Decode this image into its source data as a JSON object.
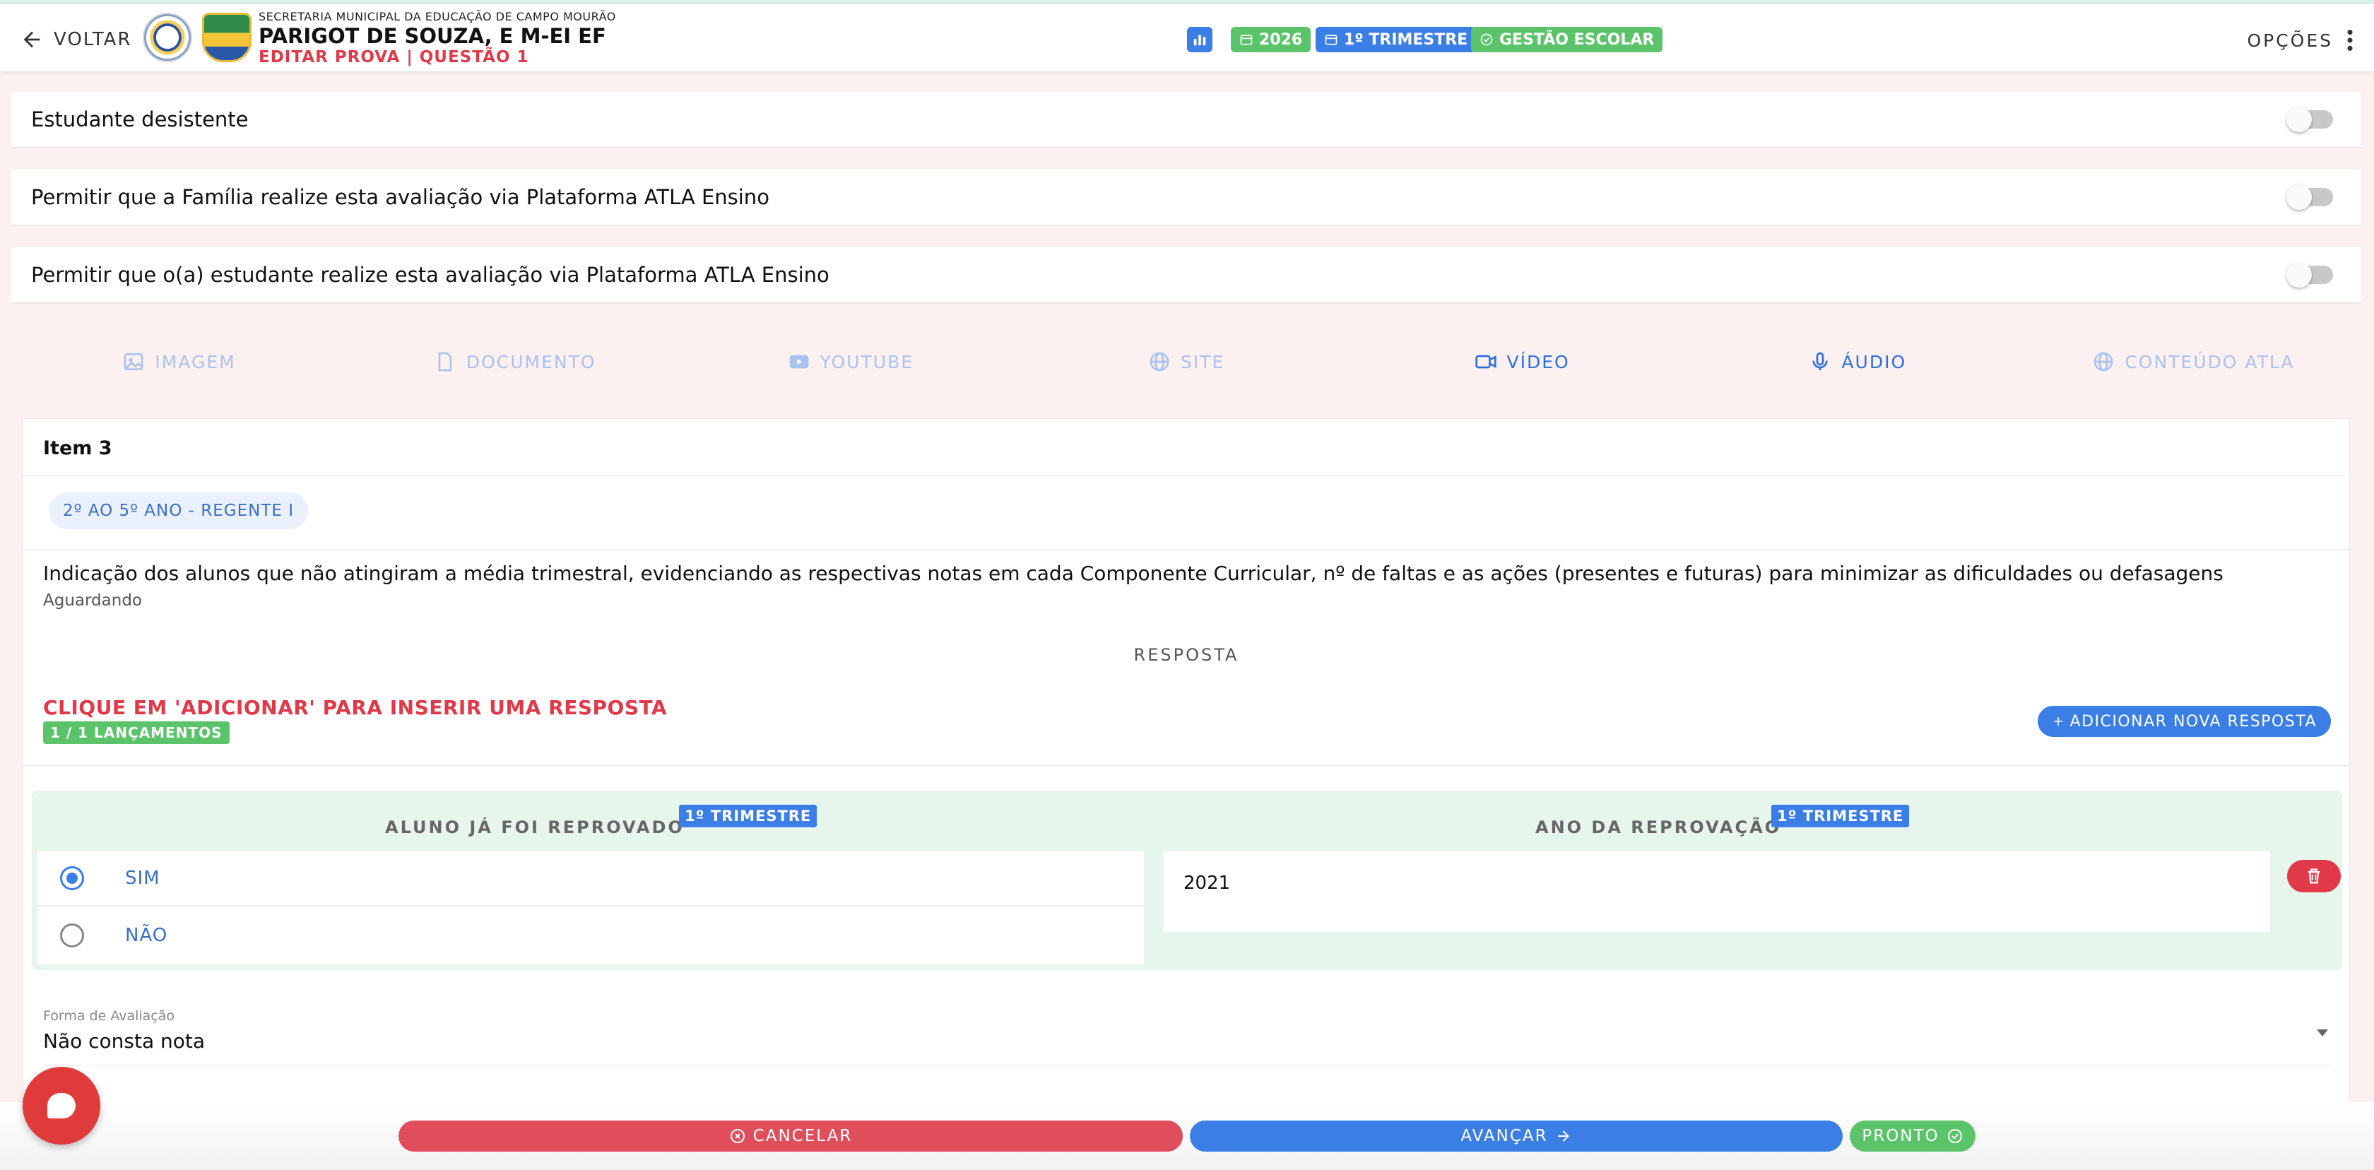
{
  "header": {
    "back_label": "VOLTAR",
    "org_name": "SECRETARIA MUNICIPAL DA EDUCAÇÃO DE CAMPO MOURÃO",
    "school_name": "PARIGOT DE SOUZA, E M-EI EF",
    "edit_title": "EDITAR PROVA | QUESTÃO 1",
    "chips": {
      "year": "2026",
      "term": "1º TRIMESTRE",
      "management": "GESTÃO ESCOLAR"
    },
    "options_label": "OPÇÕES"
  },
  "toggles": [
    {
      "label": "Estudante desistente",
      "on": false
    },
    {
      "label": "Permitir que a Família realize esta avaliação via Plataforma ATLA Ensino",
      "on": false
    },
    {
      "label": "Permitir que o(a) estudante realize esta avaliação via Plataforma ATLA Ensino",
      "on": false
    }
  ],
  "media_tabs": [
    "IMAGEM",
    "DOCUMENTO",
    "YOUTUBE",
    "SITE",
    "VÍDEO",
    "ÁUDIO",
    "CONTEÚDO ATLA"
  ],
  "card": {
    "item_title": "Item 3",
    "grade_chip": "2º AO 5º ANO - REGENTE I",
    "question": "Indicação dos alunos que não atingiram a média trimestral, evidenciando as respectivas notas em cada Componente Curricular, nº de faltas e as ações (presentes e futuras) para minimizar as dificuldades ou defasagens",
    "status": "Aguardando",
    "response_title": "RESPOSTA",
    "instruction": "CLIQUE EM 'ADICIONAR' PARA INSERIR UMA RESPOSTA",
    "launch_count": "1 / 1 LANÇAMENTOS",
    "add_button": "ADICIONAR NOVA RESPOSTA",
    "answer": {
      "col1_title": "ALUNO JÁ FOI REPROVADO",
      "col1_badge": "1º TRIMESTRE",
      "col2_title": "ANO DA REPROVAÇÃO",
      "col2_badge": "1º TRIMESTRE",
      "options": [
        {
          "label": "SIM",
          "selected": true
        },
        {
          "label": "NÃO",
          "selected": false
        }
      ],
      "year_value": "2021"
    },
    "eval_label": "Forma de Avaliação",
    "eval_value": "Não consta nota"
  },
  "footer": {
    "cancel": "CANCELAR",
    "next": "AVANÇAR",
    "done": "PRONTO"
  },
  "colors": {
    "primary": "#3b7ee6",
    "success": "#5bc46a",
    "danger": "#e03a4a",
    "background": "#fdf0f0"
  }
}
